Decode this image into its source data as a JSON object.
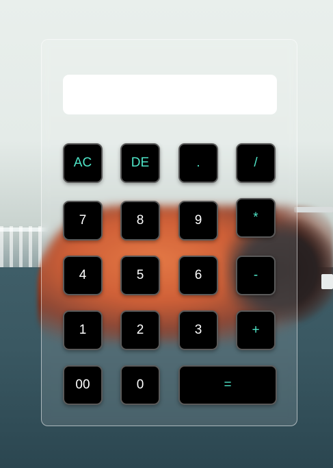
{
  "display": {
    "value": ""
  },
  "keys": {
    "clear": "AC",
    "delete": "DE",
    "dot": ".",
    "divide": "/",
    "seven": "7",
    "eight": "8",
    "nine": "9",
    "multiply": "*",
    "four": "4",
    "five": "5",
    "six": "6",
    "subtract": "-",
    "one": "1",
    "two": "2",
    "three": "3",
    "add": "+",
    "double_zero": "00",
    "zero": "0",
    "equals": "="
  },
  "colors": {
    "operator": "#4fe6c8",
    "digit": "#ffffff",
    "key_background": "#000000"
  }
}
